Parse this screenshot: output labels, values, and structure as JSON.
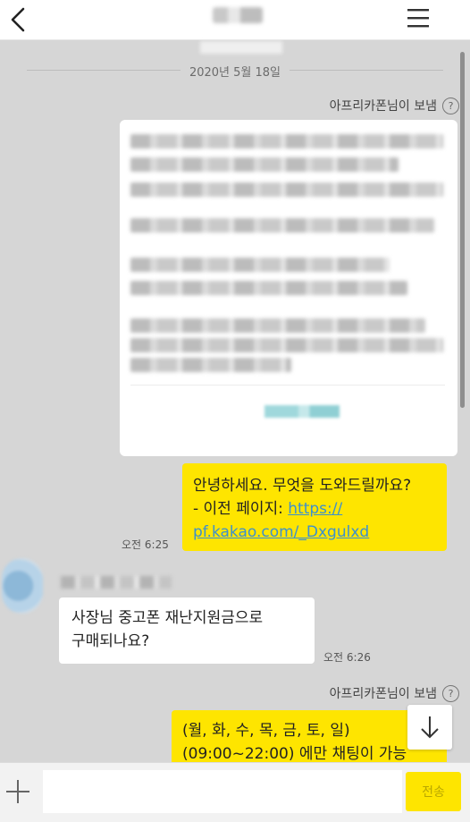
{
  "header": {
    "title": "",
    "back_icon": "chevron-left-icon",
    "menu_icon": "hamburger-menu-icon"
  },
  "date_divider": "2020년 5월 18일",
  "sent_by_1": "아프리카폰님이 보냄",
  "sent_by_2": "아프리카폰님이 보냄",
  "help_glyph": "?",
  "messages": {
    "greeting": {
      "line1": "안녕하세요. 무엇을 도와드릴까요?",
      "line2_prefix": "- 이전 페이지: ",
      "link_part1": "https://",
      "link_part2": "pf.kakao.com/_Dxgulxd",
      "time": "오전 6:25"
    },
    "user_question": {
      "line1": "사장님 중고폰 재난지원금으로",
      "line2": "구매되나요?",
      "time": "오전 6:26"
    },
    "hours": {
      "line1": "(월, 화, 수, 목, 금, 토, 일)",
      "line2": "(09:00~22:00) 에만 채팅이 가능"
    }
  },
  "composer": {
    "input_value": "",
    "input_placeholder": "",
    "send_label": "전송",
    "plus_icon": "plus-icon"
  },
  "colors": {
    "bubble_yellow": "#fee500",
    "chat_background": "#d6d6d6",
    "link": "#3c90ce"
  }
}
